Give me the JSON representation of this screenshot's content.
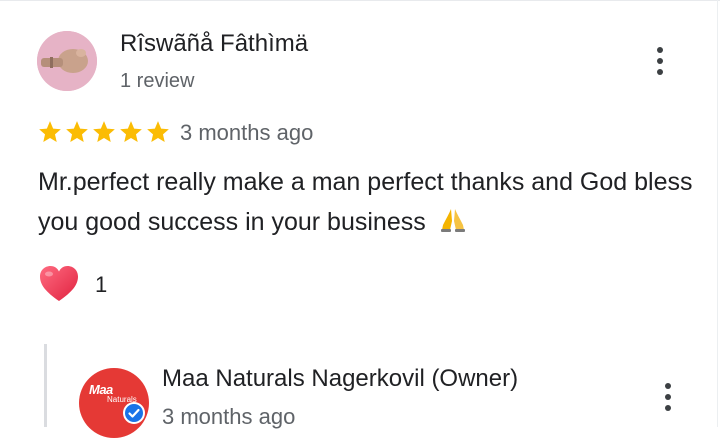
{
  "review": {
    "author_name": "Rîswãñå Fâthìmä",
    "author_reviews": "1 review",
    "rating": 5,
    "date": "3 months ago",
    "text": "Mr.perfect really make a man perfect thanks and God bless you good success in your business",
    "emoji": "🙏",
    "like_count": "1"
  },
  "reply": {
    "owner_name": "Maa Naturals Nagerkovil (Owner)",
    "date": "3 months ago",
    "logo_text": "Maa",
    "logo_sub": "Naturals"
  },
  "colors": {
    "star": "#fbbc04",
    "heart": "#e8394f",
    "owner_avatar": "#e53935",
    "verified": "#1a73e8"
  },
  "icons": [
    "more-vert-icon",
    "star-icon",
    "heart-icon",
    "pray-emoji-icon",
    "verified-badge-icon"
  ]
}
